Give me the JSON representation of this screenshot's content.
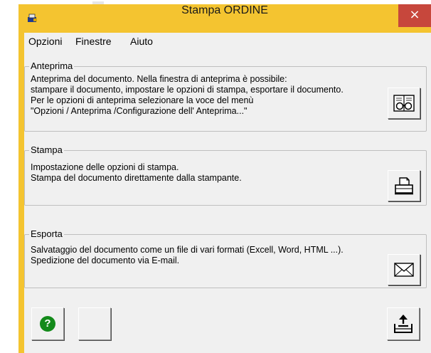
{
  "window": {
    "title": "Stampa ORDINE",
    "close_glyph": "×",
    "accent_color": "#f4c430",
    "close_color": "#c7473c"
  },
  "menu": {
    "items": [
      "Opzioni",
      "Finestre",
      "Aiuto"
    ]
  },
  "preview_group": {
    "legend": "Anteprima",
    "text": "Anteprima del documento. Nella finestra di anteprima è possibile:\nstampare il documento, impostare le opzioni di stampa, esportare il documento.\nPer le opzioni di anteprima selezionare la voce del menù\n\"Opzioni / Anteprima /Configurazione dell' Anteprima...\"",
    "button_icon": "glasses-icon"
  },
  "print_group": {
    "legend": "Stampa",
    "text": "Impostazione delle opzioni di stampa.\nStampa del documento direttamente dalla stampante.",
    "button_icon": "printer-icon"
  },
  "export_group": {
    "legend": "Esporta",
    "text": "Salvataggio del documento come un file di vari formati (Excell, Word, HTML ...).\nSpedizione del documento via E-mail.",
    "button_icon": "envelope-icon"
  },
  "bottom": {
    "help_glyph": "?",
    "help_icon": "help-icon",
    "help_color": "#138a1a",
    "exit_icon": "upload-tray-icon"
  }
}
